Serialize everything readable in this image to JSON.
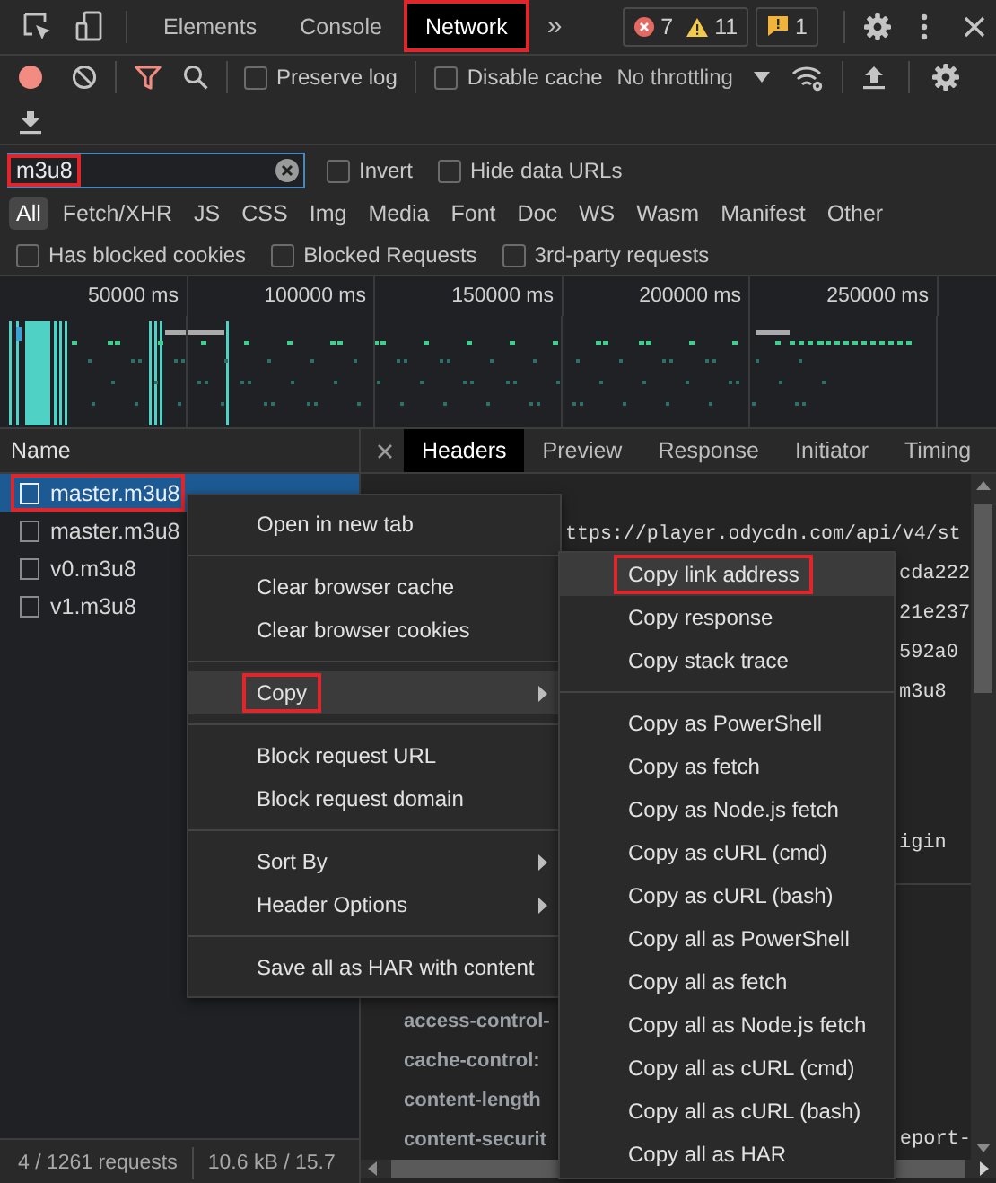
{
  "tabs": [
    {
      "label": "Elements",
      "selected": false,
      "highlighted": false
    },
    {
      "label": "Console",
      "selected": false,
      "highlighted": false
    },
    {
      "label": "Network",
      "selected": true,
      "highlighted": true
    }
  ],
  "more_tabs": "»",
  "counters": {
    "errors": "7",
    "warnings": "11",
    "issues": "1"
  },
  "toolbar": {
    "recording": true,
    "preserve_log": {
      "label": "Preserve log",
      "checked": false
    },
    "disable_cache": {
      "label": "Disable cache",
      "checked": false
    },
    "throttling": "No throttling"
  },
  "filter": {
    "value": "m3u8",
    "highlighted": true,
    "invert": {
      "label": "Invert",
      "checked": false
    },
    "hide_data_urls": {
      "label": "Hide data URLs",
      "checked": false
    }
  },
  "type_filters": [
    {
      "label": "All",
      "selected": true
    },
    {
      "label": "Fetch/XHR",
      "selected": false
    },
    {
      "label": "JS",
      "selected": false
    },
    {
      "label": "CSS",
      "selected": false
    },
    {
      "label": "Img",
      "selected": false
    },
    {
      "label": "Media",
      "selected": false
    },
    {
      "label": "Font",
      "selected": false
    },
    {
      "label": "Doc",
      "selected": false
    },
    {
      "label": "WS",
      "selected": false
    },
    {
      "label": "Wasm",
      "selected": false
    },
    {
      "label": "Manifest",
      "selected": false
    },
    {
      "label": "Other",
      "selected": false
    }
  ],
  "blocked_filters": [
    {
      "label": "Has blocked cookies",
      "checked": false
    },
    {
      "label": "Blocked Requests",
      "checked": false
    },
    {
      "label": "3rd-party requests",
      "checked": false
    }
  ],
  "overview": {
    "ticks": [
      "50000 ms",
      "100000 ms",
      "150000 ms",
      "200000 ms",
      "250000 ms"
    ]
  },
  "requests": {
    "header": "Name",
    "rows": [
      {
        "name": "master.m3u8",
        "selected": true,
        "highlighted": true
      },
      {
        "name": "master.m3u8",
        "selected": false,
        "highlighted": false
      },
      {
        "name": "v0.m3u8",
        "selected": false,
        "highlighted": false
      },
      {
        "name": "v1.m3u8",
        "selected": false,
        "highlighted": false
      }
    ]
  },
  "details": {
    "tabs": [
      {
        "label": "Headers",
        "selected": true
      },
      {
        "label": "Preview",
        "selected": false
      },
      {
        "label": "Response",
        "selected": false
      },
      {
        "label": "Initiator",
        "selected": false
      },
      {
        "label": "Timing",
        "selected": false
      }
    ],
    "general": {
      "url": "ttps://player.odycdn.com/api/v4/st",
      "tails": [
        [
          "cda222",
          "21e237",
          "592a0",
          "m3u8"
        ],
        [
          "igin"
        ]
      ]
    },
    "headers": [
      {
        "name": "access-control-"
      },
      {
        "name": "cache-control:"
      },
      {
        "name": "content-length"
      },
      {
        "name": "content-securit",
        "tail": "eport-"
      }
    ]
  },
  "status": {
    "requests": "4 / 1261 requests",
    "transferred": "10.6 kB / 15.7"
  },
  "context_menu": {
    "groups": [
      [
        {
          "label": "Open in new tab",
          "submenu": false,
          "hovered": false,
          "highlighted": false
        }
      ],
      [
        {
          "label": "Clear browser cache",
          "submenu": false,
          "hovered": false,
          "highlighted": false
        },
        {
          "label": "Clear browser cookies",
          "submenu": false,
          "hovered": false,
          "highlighted": false
        }
      ],
      [
        {
          "label": "Copy",
          "submenu": true,
          "hovered": true,
          "highlighted": true
        }
      ],
      [
        {
          "label": "Block request URL",
          "submenu": false,
          "hovered": false,
          "highlighted": false
        },
        {
          "label": "Block request domain",
          "submenu": false,
          "hovered": false,
          "highlighted": false
        }
      ],
      [
        {
          "label": "Sort By",
          "submenu": true,
          "hovered": false,
          "highlighted": false
        },
        {
          "label": "Header Options",
          "submenu": true,
          "hovered": false,
          "highlighted": false
        }
      ],
      [
        {
          "label": "Save all as HAR with content",
          "submenu": false,
          "hovered": false,
          "highlighted": false
        }
      ]
    ]
  },
  "copy_submenu": {
    "groups": [
      [
        {
          "label": "Copy link address",
          "submenu": false,
          "hovered": true,
          "highlighted": true
        },
        {
          "label": "Copy response",
          "submenu": false,
          "hovered": false,
          "highlighted": false
        },
        {
          "label": "Copy stack trace",
          "submenu": false,
          "hovered": false,
          "highlighted": false
        }
      ],
      [
        {
          "label": "Copy as PowerShell",
          "submenu": false,
          "hovered": false,
          "highlighted": false
        },
        {
          "label": "Copy as fetch",
          "submenu": false,
          "hovered": false,
          "highlighted": false
        },
        {
          "label": "Copy as Node.js fetch",
          "submenu": false,
          "hovered": false,
          "highlighted": false
        },
        {
          "label": "Copy as cURL (cmd)",
          "submenu": false,
          "hovered": false,
          "highlighted": false
        },
        {
          "label": "Copy as cURL (bash)",
          "submenu": false,
          "hovered": false,
          "highlighted": false
        },
        {
          "label": "Copy all as PowerShell",
          "submenu": false,
          "hovered": false,
          "highlighted": false
        },
        {
          "label": "Copy all as fetch",
          "submenu": false,
          "hovered": false,
          "highlighted": false
        },
        {
          "label": "Copy all as Node.js fetch",
          "submenu": false,
          "hovered": false,
          "highlighted": false
        },
        {
          "label": "Copy all as cURL (cmd)",
          "submenu": false,
          "hovered": false,
          "highlighted": false
        },
        {
          "label": "Copy all as cURL (bash)",
          "submenu": false,
          "hovered": false,
          "highlighted": false
        },
        {
          "label": "Copy all as HAR",
          "submenu": false,
          "hovered": false,
          "highlighted": false
        }
      ]
    ]
  }
}
